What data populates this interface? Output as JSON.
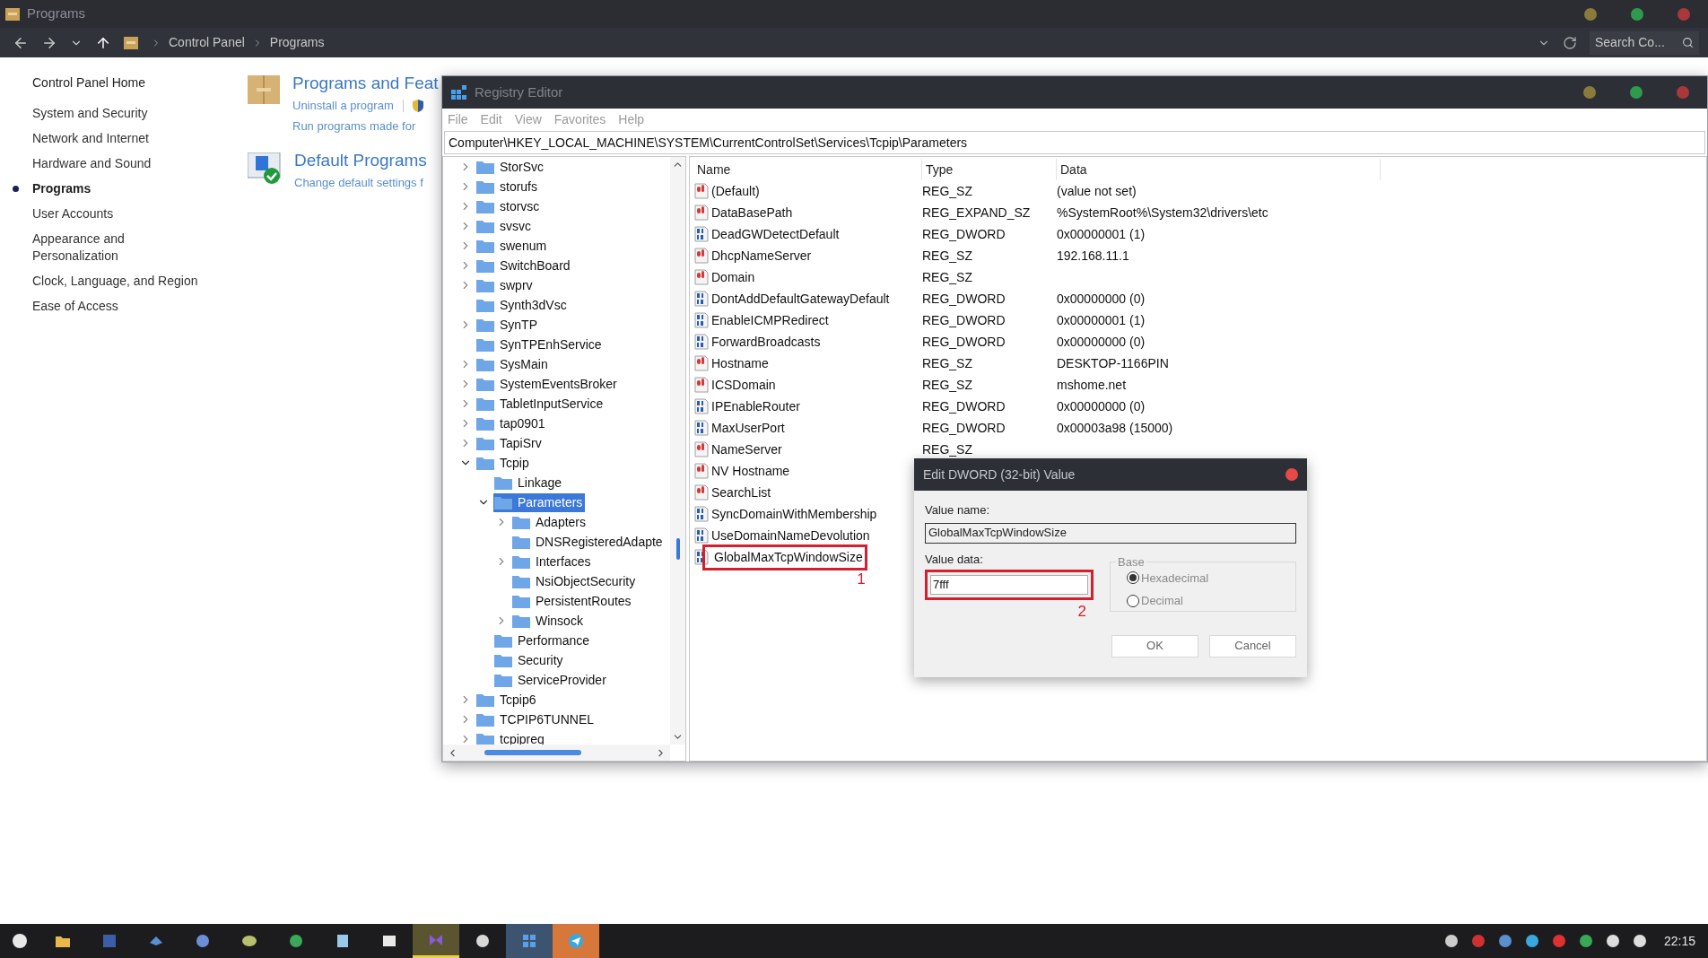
{
  "control_panel": {
    "window_title": "Programs",
    "breadcrumb": [
      "Control Panel",
      "Programs"
    ],
    "search": {
      "placeholder": "Search Co..."
    },
    "home_link": "Control Panel Home",
    "nav": [
      {
        "label": "System and Security",
        "selected": false
      },
      {
        "label": "Network and Internet",
        "selected": false
      },
      {
        "label": "Hardware and Sound",
        "selected": false
      },
      {
        "label": "Programs",
        "selected": true
      },
      {
        "label": "User Accounts",
        "selected": false
      },
      {
        "label": "Appearance and Personalization",
        "selected": false
      },
      {
        "label": "Clock, Language, and Region",
        "selected": false
      },
      {
        "label": "Ease of Access",
        "selected": false
      }
    ],
    "sections": [
      {
        "kind": "box",
        "title": "Programs and Feat",
        "links": [
          "Uninstall a program",
          "Run programs made for"
        ]
      },
      {
        "kind": "defaults",
        "title": "Default Programs",
        "links": [
          "Change default settings f"
        ]
      }
    ]
  },
  "registry_editor": {
    "title": "Registry Editor",
    "menu": [
      {
        "label": "File",
        "disabled": true
      },
      {
        "label": "Edit",
        "disabled": true
      },
      {
        "label": "View",
        "disabled": true
      },
      {
        "label": "Favorites",
        "disabled": true
      },
      {
        "label": "Help",
        "disabled": true
      }
    ],
    "address": "Computer\\HKEY_LOCAL_MACHINE\\SYSTEM\\CurrentControlSet\\Services\\Tcpip\\Parameters",
    "tree": [
      {
        "label": "StorSvc",
        "expanded": false,
        "selected": false
      },
      {
        "label": "storufs",
        "expanded": false,
        "selected": false
      },
      {
        "label": "storvsc",
        "expanded": false,
        "selected": false
      },
      {
        "label": "svsvc",
        "expanded": false,
        "selected": false
      },
      {
        "label": "swenum",
        "expanded": false,
        "selected": false
      },
      {
        "label": "SwitchBoard",
        "expanded": false,
        "selected": false
      },
      {
        "label": "swprv",
        "expanded": false,
        "selected": false
      },
      {
        "label": "Synth3dVsc",
        "selected": false
      },
      {
        "label": "SynTP",
        "expanded": false,
        "selected": false
      },
      {
        "label": "SynTPEnhService",
        "selected": false
      },
      {
        "label": "SysMain",
        "expanded": false,
        "selected": false
      },
      {
        "label": "SystemEventsBroker",
        "expanded": false,
        "selected": false
      },
      {
        "label": "TabletInputService",
        "expanded": false,
        "selected": false
      },
      {
        "label": "tap0901",
        "expanded": false,
        "selected": false
      },
      {
        "label": "TapiSrv",
        "expanded": false,
        "selected": false
      },
      {
        "label": "Tcpip",
        "expanded": true,
        "selected": false,
        "children": [
          {
            "label": "Linkage",
            "selected": false
          },
          {
            "label": "Parameters",
            "expanded": true,
            "selected": true,
            "children": [
              {
                "label": "Adapters",
                "expanded": false,
                "selected": false
              },
              {
                "label": "DNSRegisteredAdapte",
                "selected": false
              },
              {
                "label": "Interfaces",
                "expanded": false,
                "selected": false
              },
              {
                "label": "NsiObjectSecurity",
                "selected": false
              },
              {
                "label": "PersistentRoutes",
                "selected": false
              },
              {
                "label": "Winsock",
                "expanded": false,
                "selected": false
              }
            ]
          },
          {
            "label": "Performance",
            "selected": false
          },
          {
            "label": "Security",
            "selected": false
          },
          {
            "label": "ServiceProvider",
            "selected": false
          }
        ]
      },
      {
        "label": "Tcpip6",
        "expanded": false,
        "selected": false
      },
      {
        "label": "TCPIP6TUNNEL",
        "expanded": false,
        "selected": false
      },
      {
        "label": "tcpipreg",
        "expanded": false,
        "selected": false
      }
    ],
    "columns": [
      "Name",
      "Type",
      "Data"
    ],
    "values": [
      {
        "kind": "string",
        "name": "(Default)",
        "type": "REG_SZ",
        "data": "(value not set)"
      },
      {
        "kind": "string",
        "name": "DataBasePath",
        "type": "REG_EXPAND_SZ",
        "data": "%SystemRoot%\\System32\\drivers\\etc"
      },
      {
        "kind": "binary",
        "name": "DeadGWDetectDefault",
        "type": "REG_DWORD",
        "data": "0x00000001 (1)"
      },
      {
        "kind": "string",
        "name": "DhcpNameServer",
        "type": "REG_SZ",
        "data": "192.168.11.1"
      },
      {
        "kind": "string",
        "name": "Domain",
        "type": "REG_SZ"
      },
      {
        "kind": "binary",
        "name": "DontAddDefaultGatewayDefault",
        "type": "REG_DWORD",
        "data": "0x00000000 (0)"
      },
      {
        "kind": "binary",
        "name": "EnableICMPRedirect",
        "type": "REG_DWORD",
        "data": "0x00000001 (1)"
      },
      {
        "kind": "binary",
        "name": "ForwardBroadcasts",
        "type": "REG_DWORD",
        "data": "0x00000000 (0)"
      },
      {
        "kind": "string",
        "name": "Hostname",
        "type": "REG_SZ",
        "data": "DESKTOP-1166PIN"
      },
      {
        "kind": "string",
        "name": "ICSDomain",
        "type": "REG_SZ",
        "data": "mshome.net"
      },
      {
        "kind": "binary",
        "name": "IPEnableRouter",
        "type": "REG_DWORD",
        "data": "0x00000000 (0)"
      },
      {
        "kind": "binary",
        "name": "MaxUserPort",
        "type": "REG_DWORD",
        "data": "0x00003a98 (15000)"
      },
      {
        "kind": "string",
        "name": "NameServer",
        "type": "REG_SZ"
      },
      {
        "kind": "string",
        "name": "NV Hostname"
      },
      {
        "kind": "string",
        "name": "SearchList"
      },
      {
        "kind": "binary",
        "name": "SyncDomainWithMembership"
      },
      {
        "kind": "binary",
        "name": "UseDomainNameDevolution"
      },
      {
        "kind": "binary",
        "name": "GlobalMaxTcpWindowSize",
        "annotation": "1"
      }
    ]
  },
  "dialog": {
    "title": "Edit DWORD (32-bit) Value",
    "value_name_label": "Value name:",
    "value_name": "GlobalMaxTcpWindowSize",
    "value_data_label": "Value data:",
    "value_data": "7fff",
    "value_data_annotation": "2",
    "base": {
      "label": "Base",
      "options": [
        {
          "label": "Hexadecimal",
          "selected": true
        },
        {
          "label": "Decimal",
          "selected": false
        }
      ]
    },
    "buttons": [
      "OK",
      "Cancel"
    ]
  },
  "taskbar": {
    "apps": [
      {
        "active": false,
        "hovered": false,
        "flashing": false
      },
      {
        "active": false,
        "hovered": false,
        "flashing": false
      },
      {
        "active": false,
        "hovered": false,
        "flashing": false
      },
      {
        "active": false,
        "hovered": false,
        "flashing": false
      },
      {
        "active": false,
        "hovered": false,
        "flashing": false
      },
      {
        "active": false,
        "hovered": false,
        "flashing": false
      },
      {
        "active": false,
        "hovered": false,
        "flashing": false
      },
      {
        "active": false,
        "hovered": false,
        "flashing": false
      },
      {
        "active": true,
        "hovered": false,
        "flashing": false
      },
      {
        "active": false,
        "hovered": false,
        "flashing": false
      },
      {
        "active": false,
        "hovered": true,
        "flashing": false
      },
      {
        "active": false,
        "hovered": false,
        "flashing": true
      }
    ],
    "clock": "22:15"
  }
}
